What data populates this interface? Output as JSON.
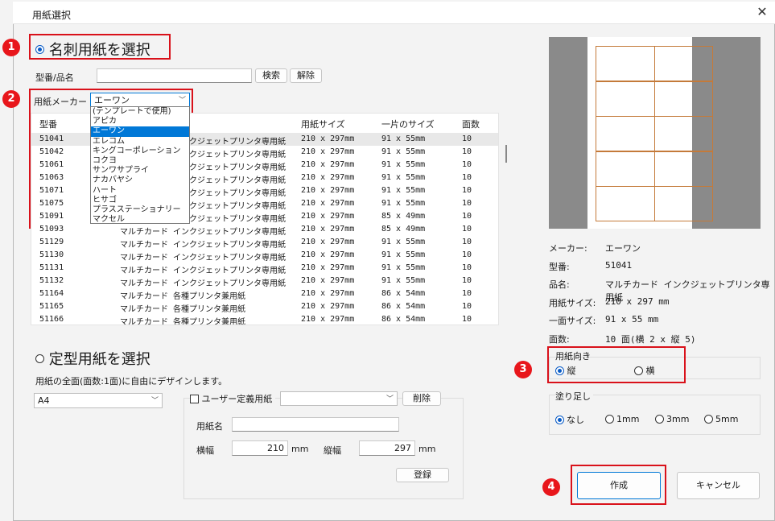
{
  "window": {
    "title": "用紙選択"
  },
  "callouts": [
    "1",
    "2",
    "3",
    "4"
  ],
  "meishi": {
    "label": "名刺用紙を選択",
    "selected": true
  },
  "search": {
    "label": "型番/品名",
    "value": "",
    "search_btn": "検索",
    "clear_btn": "解除"
  },
  "maker": {
    "label": "用紙メーカー",
    "selected": "エーワン"
  },
  "dropdown_items": [
    "(テンプレートで使用)",
    "アピカ",
    "エーワン",
    "エレコム",
    "キングコーポレーション",
    "コクヨ",
    "サンワサプライ",
    "ナカバヤシ",
    "ハート",
    "ヒサゴ",
    "プラスステーショナリー",
    "マクセル"
  ],
  "table": {
    "headers": [
      "型番",
      "",
      "用紙サイズ",
      "一片のサイズ",
      "面数"
    ],
    "rows": [
      [
        "51041",
        "マルチカード インクジェットプリンタ専用紙",
        "210 x 297mm",
        "91 x 55mm",
        "10"
      ],
      [
        "51042",
        "マルチカード インクジェットプリンタ専用紙",
        "210 x 297mm",
        "91 x 55mm",
        "10"
      ],
      [
        "51061",
        "マルチカード インクジェットプリンタ専用紙",
        "210 x 297mm",
        "91 x 55mm",
        "10"
      ],
      [
        "51063",
        "マルチカード インクジェットプリンタ専用紙",
        "210 x 297mm",
        "91 x 55mm",
        "10"
      ],
      [
        "51071",
        "マルチカード インクジェットプリンタ専用紙",
        "210 x 297mm",
        "91 x 55mm",
        "10"
      ],
      [
        "51075",
        "マルチカード インクジェットプリンタ専用紙",
        "210 x 297mm",
        "91 x 55mm",
        "10"
      ],
      [
        "51091",
        "マルチカード インクジェットプリンタ専用紙",
        "210 x 297mm",
        "85 x 49mm",
        "10"
      ],
      [
        "51093",
        "マルチカード インクジェットプリンタ専用紙",
        "210 x 297mm",
        "85 x 49mm",
        "10"
      ],
      [
        "51129",
        "マルチカード インクジェットプリンタ専用紙",
        "210 x 297mm",
        "91 x 55mm",
        "10"
      ],
      [
        "51130",
        "マルチカード インクジェットプリンタ専用紙",
        "210 x 297mm",
        "91 x 55mm",
        "10"
      ],
      [
        "51131",
        "マルチカード インクジェットプリンタ専用紙",
        "210 x 297mm",
        "91 x 55mm",
        "10"
      ],
      [
        "51132",
        "マルチカード インクジェットプリンタ専用紙",
        "210 x 297mm",
        "91 x 55mm",
        "10"
      ],
      [
        "51164",
        "マルチカード 各種プリンタ兼用紙",
        "210 x 297mm",
        "86 x 54mm",
        "10"
      ],
      [
        "51165",
        "マルチカード 各種プリンタ兼用紙",
        "210 x 297mm",
        "86 x 54mm",
        "10"
      ],
      [
        "51166",
        "マルチカード 各種プリンタ兼用紙",
        "210 x 297mm",
        "86 x 54mm",
        "10"
      ]
    ]
  },
  "teikei": {
    "label": "定型用紙を選択",
    "desc": "用紙の全面(面数:1面)に自由にデザインします。",
    "size": "A4"
  },
  "user_def": {
    "label": "ユーザー定義用紙",
    "delete_btn": "削除",
    "name_label": "用紙名",
    "width_label": "横幅",
    "width_val": "210",
    "height_label": "縦幅",
    "height_val": "297",
    "unit": "mm",
    "register_btn": "登録"
  },
  "info": [
    {
      "label": "メーカー:",
      "value": "エーワン"
    },
    {
      "label": "型番:",
      "value": "51041"
    },
    {
      "label": "品名:",
      "value": "マルチカード インクジェットプリンタ専用紙"
    },
    {
      "label": "用紙サイズ:",
      "value": "210 x 297 mm"
    },
    {
      "label": "一面サイズ:",
      "value": "91 x 55 mm"
    },
    {
      "label": "面数:",
      "value": "10 面(横 2 x 縦 5)"
    }
  ],
  "orientation": {
    "title": "用紙向き",
    "portrait": "縦",
    "landscape": "横"
  },
  "bleed": {
    "title": "塗り足し",
    "options": [
      "なし",
      "1mm",
      "3mm",
      "5mm"
    ]
  },
  "actions": {
    "create": "作成",
    "cancel": "キャンセル"
  },
  "colors": {
    "accent": "#0078d7",
    "callout": "#e8161b",
    "card_line": "#c47a3a"
  }
}
